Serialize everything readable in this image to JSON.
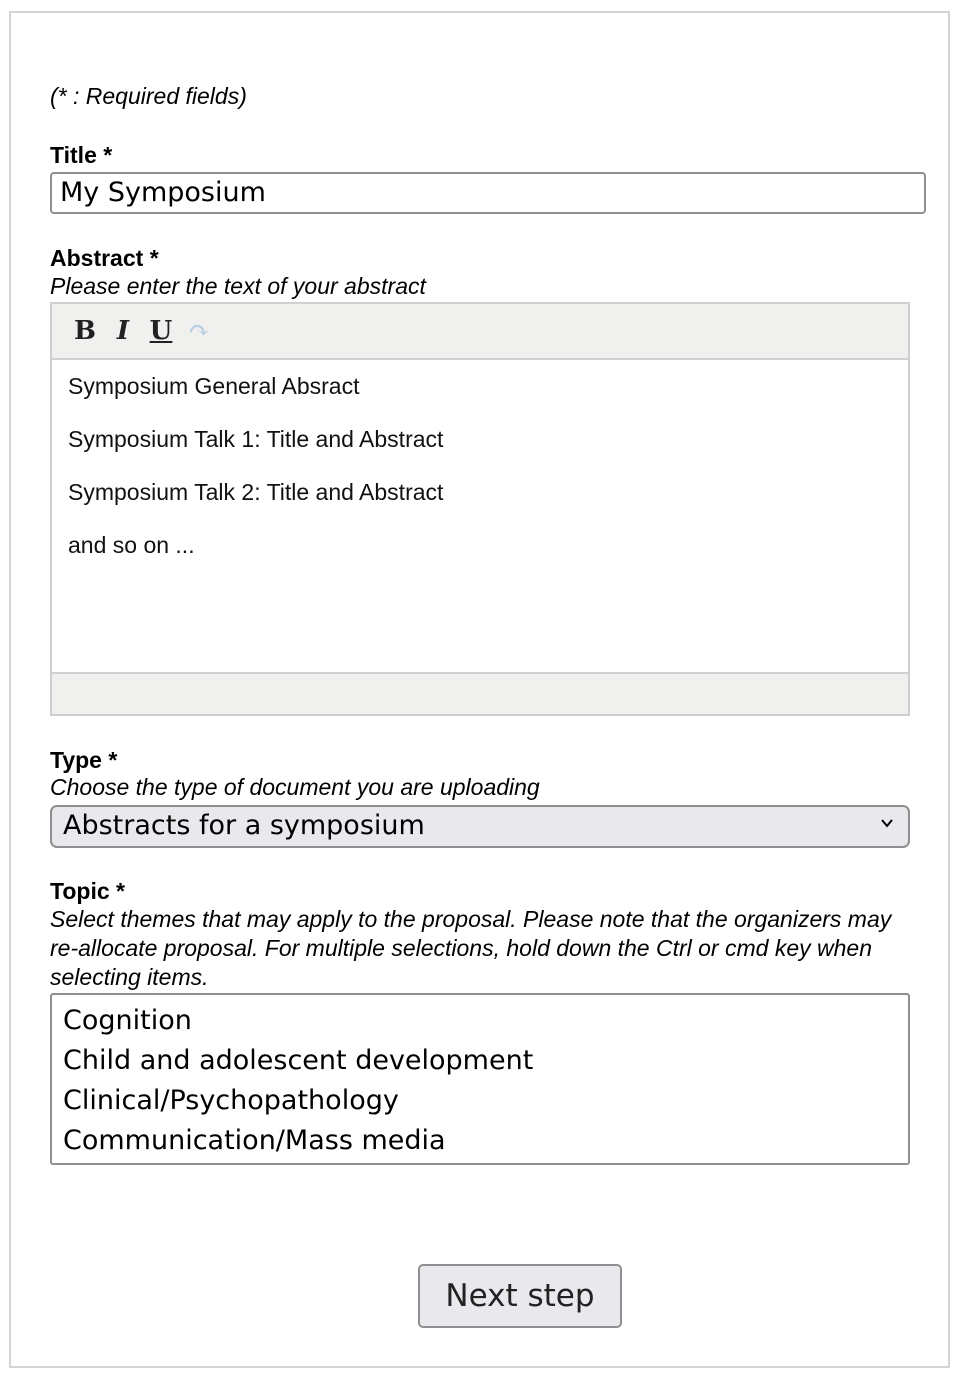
{
  "form": {
    "required_note": "(* : Required fields)",
    "title": {
      "label": "Title *",
      "value": "My Symposium"
    },
    "abstract": {
      "label": "Abstract *",
      "help": "Please enter the text of your abstract",
      "toolbar": {
        "bold": "B",
        "italic": "I",
        "underline": "U",
        "redo": "↷"
      },
      "paragraphs": [
        "Symposium General Absract",
        "Symposium Talk 1: Title and Abstract",
        "Symposium Talk 2: Title and Abstract",
        "and so on ..."
      ]
    },
    "type": {
      "label": "Type *",
      "help": "Choose the type of document you are uploading",
      "selected": "Abstracts for a symposium"
    },
    "topic": {
      "label": "Topic *",
      "help": "Select themes that may apply to the proposal. Please note that the organizers may re-allocate proposal. For multiple selections, hold down the Ctrl or cmd key when selecting items.",
      "options": [
        "Cognition",
        "Child and adolescent development",
        "Clinical/Psychopathology",
        "Communication/Mass media"
      ]
    },
    "next_button": "Next step"
  }
}
